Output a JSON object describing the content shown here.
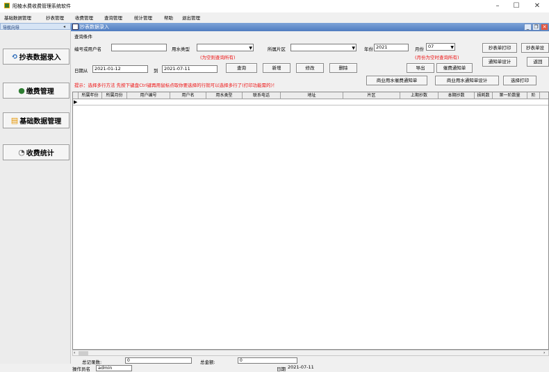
{
  "window": {
    "title": "阳棱水费收费管理系统软件",
    "controls": {
      "minimize": "–",
      "maximize": "☐",
      "close": "✕"
    }
  },
  "menu": [
    "基础数据管理",
    "抄表管理",
    "收费管理",
    "查询管理",
    "统计管理",
    "帮助",
    "退出管理"
  ],
  "nav": {
    "title": "导航向导",
    "collapse": "◂",
    "buttons": [
      {
        "label": "抄表数据录入",
        "icon": "meter-icon"
      },
      {
        "label": "缴费管理",
        "icon": "money-bag-icon"
      },
      {
        "label": "基础数据管理",
        "icon": "database-icon"
      },
      {
        "label": "收费统计",
        "icon": "chart-icon"
      }
    ]
  },
  "child_window": {
    "title": "抄表数据录入",
    "controls": {
      "minimize": "_",
      "restore": "❐",
      "close": "✕"
    }
  },
  "query": {
    "section_label": "查询条件",
    "user_label": "编号或用户名",
    "user_value": "",
    "water_type_label": "用水类型",
    "water_type_value": "",
    "water_type_hint": "(为空则查询所有)",
    "district_label": "所属片区",
    "district_value": "",
    "year_label": "年份",
    "year_value": "2021",
    "month_label": "月份",
    "month_value": "07",
    "month_hint": "(月份为空时查询所有)",
    "date_from_label": "日期从",
    "date_from_value": "2021-01-12",
    "date_to_label": "到",
    "date_to_value": "2021-07-11"
  },
  "buttons": {
    "query": "查询",
    "add": "新增",
    "edit": "修改",
    "delete": "删除",
    "export": "导出",
    "send_notice": "催费通知单",
    "print_meter": "抄表单打印",
    "meter_design": "抄表单设",
    "notice_design": "通知单设计",
    "return": "返回",
    "commercial_notice": "商业用水催费通知单",
    "commercial_notice_design": "商业用水通知单设计",
    "select_print": "选择打印"
  },
  "tip": "提示：选择多行方法 先按下键盘Ctrl键再用鼠标点取你要选择的行就可以选择多行了(打印功能需的)！",
  "table": {
    "columns": [
      "所属年份",
      "所属月份",
      "用户编号",
      "用户名",
      "用水类型",
      "联系电话",
      "地址",
      "片区",
      "上期抄数",
      "本期抄数",
      "损耗数",
      "第一阶数量",
      "阶"
    ],
    "row_marker": "▶"
  },
  "status": {
    "total_records_label": "总记录数:",
    "total_records_value": "0",
    "total_amount_label": "总金额:",
    "total_amount_value": "0",
    "operator_label": "操作员名",
    "operator_value": "admin",
    "date_label": "日期",
    "date_value": "2021-07-11"
  }
}
